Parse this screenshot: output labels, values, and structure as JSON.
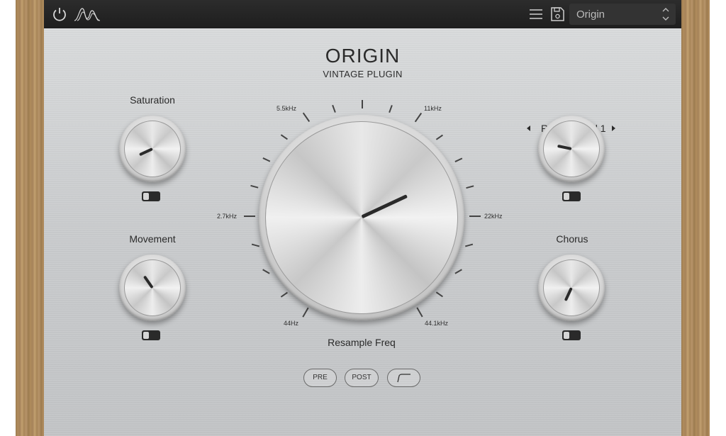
{
  "header": {
    "preset_name": "Origin",
    "icons": [
      "power-icon",
      "logo-wave-icon",
      "menu-icon",
      "save-icon",
      "updown-arrows-icon"
    ]
  },
  "title": {
    "name": "ORIGIN",
    "subtitle": "VINTAGE PLUGIN"
  },
  "knobs": {
    "saturation": {
      "label": "Saturation",
      "enabled": false
    },
    "movement": {
      "label": "Movement",
      "enabled": false
    },
    "reel": {
      "label": "Reel To Reel 1",
      "enabled": false
    },
    "chorus": {
      "label": "Chorus",
      "enabled": false
    },
    "resample": {
      "label": "Resample Freq",
      "freq_labels": [
        "5.5kHz",
        "11kHz",
        "2.7kHz",
        "22kHz",
        "44Hz",
        "44.1kHz"
      ]
    }
  },
  "buttons": {
    "pre": "PRE",
    "post": "POST"
  },
  "colors": {
    "header_bg": "#1e1e1e",
    "panel": "#cfd1d3",
    "wood": "#a88558",
    "pointer": "#2a2a2a"
  }
}
